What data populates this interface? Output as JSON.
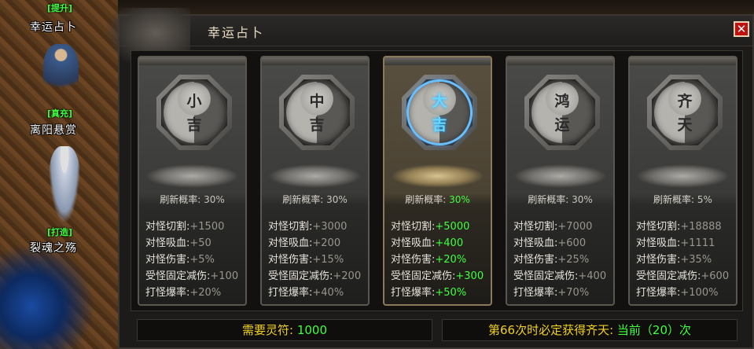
{
  "sidebar": {
    "npcs": [
      {
        "tag": "[提升]",
        "name": "幸运占卜"
      },
      {
        "tag": "[真充]",
        "name": "离阳悬赏"
      },
      {
        "tag": "[打造]",
        "name": "裂魂之殇"
      }
    ]
  },
  "panel": {
    "title": "幸运占卜",
    "close_label": "✕"
  },
  "cards": [
    {
      "char1": "小",
      "char2": "吉",
      "rate_label": "刷新概率:",
      "rate_value": "30%",
      "stats": [
        {
          "label": "对怪切割:",
          "value": "+1500"
        },
        {
          "label": "对怪吸血:",
          "value": "+50"
        },
        {
          "label": "对怪伤害:",
          "value": "+5%"
        },
        {
          "label": "受怪固定减伤:",
          "value": "+100"
        },
        {
          "label": "打怪爆率:",
          "value": "+20%"
        }
      ]
    },
    {
      "char1": "中",
      "char2": "吉",
      "rate_label": "刷新概率:",
      "rate_value": "30%",
      "stats": [
        {
          "label": "对怪切割:",
          "value": "+3000"
        },
        {
          "label": "对怪吸血:",
          "value": "+200"
        },
        {
          "label": "对怪伤害:",
          "value": "+15%"
        },
        {
          "label": "受怪固定减伤:",
          "value": "+200"
        },
        {
          "label": "打怪爆率:",
          "value": "+40%"
        }
      ]
    },
    {
      "char1": "大",
      "char2": "吉",
      "rate_label": "刷新概率:",
      "rate_value": "30%",
      "stats": [
        {
          "label": "对怪切割:",
          "value": "+5000"
        },
        {
          "label": "对怪吸血:",
          "value": "+400"
        },
        {
          "label": "对怪伤害:",
          "value": "+20%"
        },
        {
          "label": "受怪固定减伤:",
          "value": "+300"
        },
        {
          "label": "打怪爆率:",
          "value": "+50%"
        }
      ]
    },
    {
      "char1": "鸿",
      "char2": "运",
      "rate_label": "刷新概率:",
      "rate_value": "30%",
      "stats": [
        {
          "label": "对怪切割:",
          "value": "+7000"
        },
        {
          "label": "对怪吸血:",
          "value": "+600"
        },
        {
          "label": "对怪伤害:",
          "value": "+25%"
        },
        {
          "label": "受怪固定减伤:",
          "value": "+400"
        },
        {
          "label": "打怪爆率:",
          "value": "+70%"
        }
      ]
    },
    {
      "char1": "齐",
      "char2": "天",
      "rate_label": "刷新概率:",
      "rate_value": "5%",
      "stats": [
        {
          "label": "对怪切割:",
          "value": "+18888"
        },
        {
          "label": "对怪吸血:",
          "value": "+1111"
        },
        {
          "label": "对怪伤害:",
          "value": "+35%"
        },
        {
          "label": "受怪固定减伤:",
          "value": "+600"
        },
        {
          "label": "打怪爆率:",
          "value": "+100%"
        }
      ]
    }
  ],
  "footer": {
    "cost_label": "需要灵符:",
    "cost_value": "1000",
    "guarantee_label": "第66次时必定获得齐天:",
    "guarantee_value": "当前（20）次"
  },
  "colors": {
    "highlight_value": "#40ff40",
    "label_yellow": "#f0d020",
    "close_red": "#c01010"
  }
}
